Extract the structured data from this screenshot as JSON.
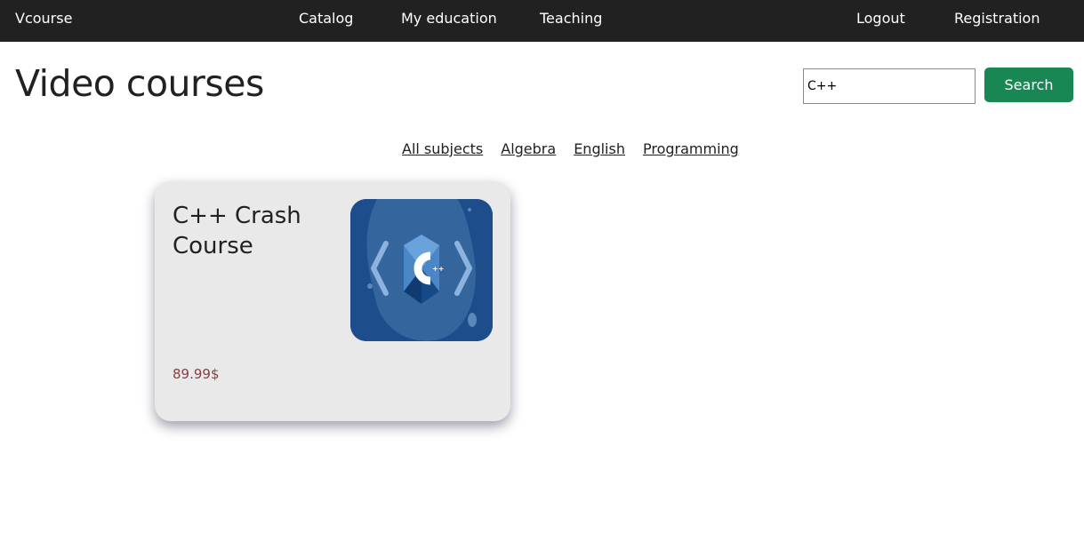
{
  "navbar": {
    "brand": "Vcourse",
    "links": [
      "Catalog",
      "My education",
      "Teaching"
    ],
    "auth": [
      "Logout",
      "Registration"
    ]
  },
  "page": {
    "title": "Video courses"
  },
  "search": {
    "value": "C++",
    "button_label": "Search"
  },
  "subjects": [
    "All subjects",
    "Algebra",
    "English",
    "Programming"
  ],
  "courses": [
    {
      "title": "C++ Crash Course",
      "price": "89.99$",
      "image_icon": "cpp-logo-icon"
    }
  ],
  "colors": {
    "navbar_bg": "#212121",
    "search_button": "#198754",
    "card_bg": "#e9e9e9",
    "price": "#8a3d3d",
    "image_bg": "#1f4e8c"
  }
}
